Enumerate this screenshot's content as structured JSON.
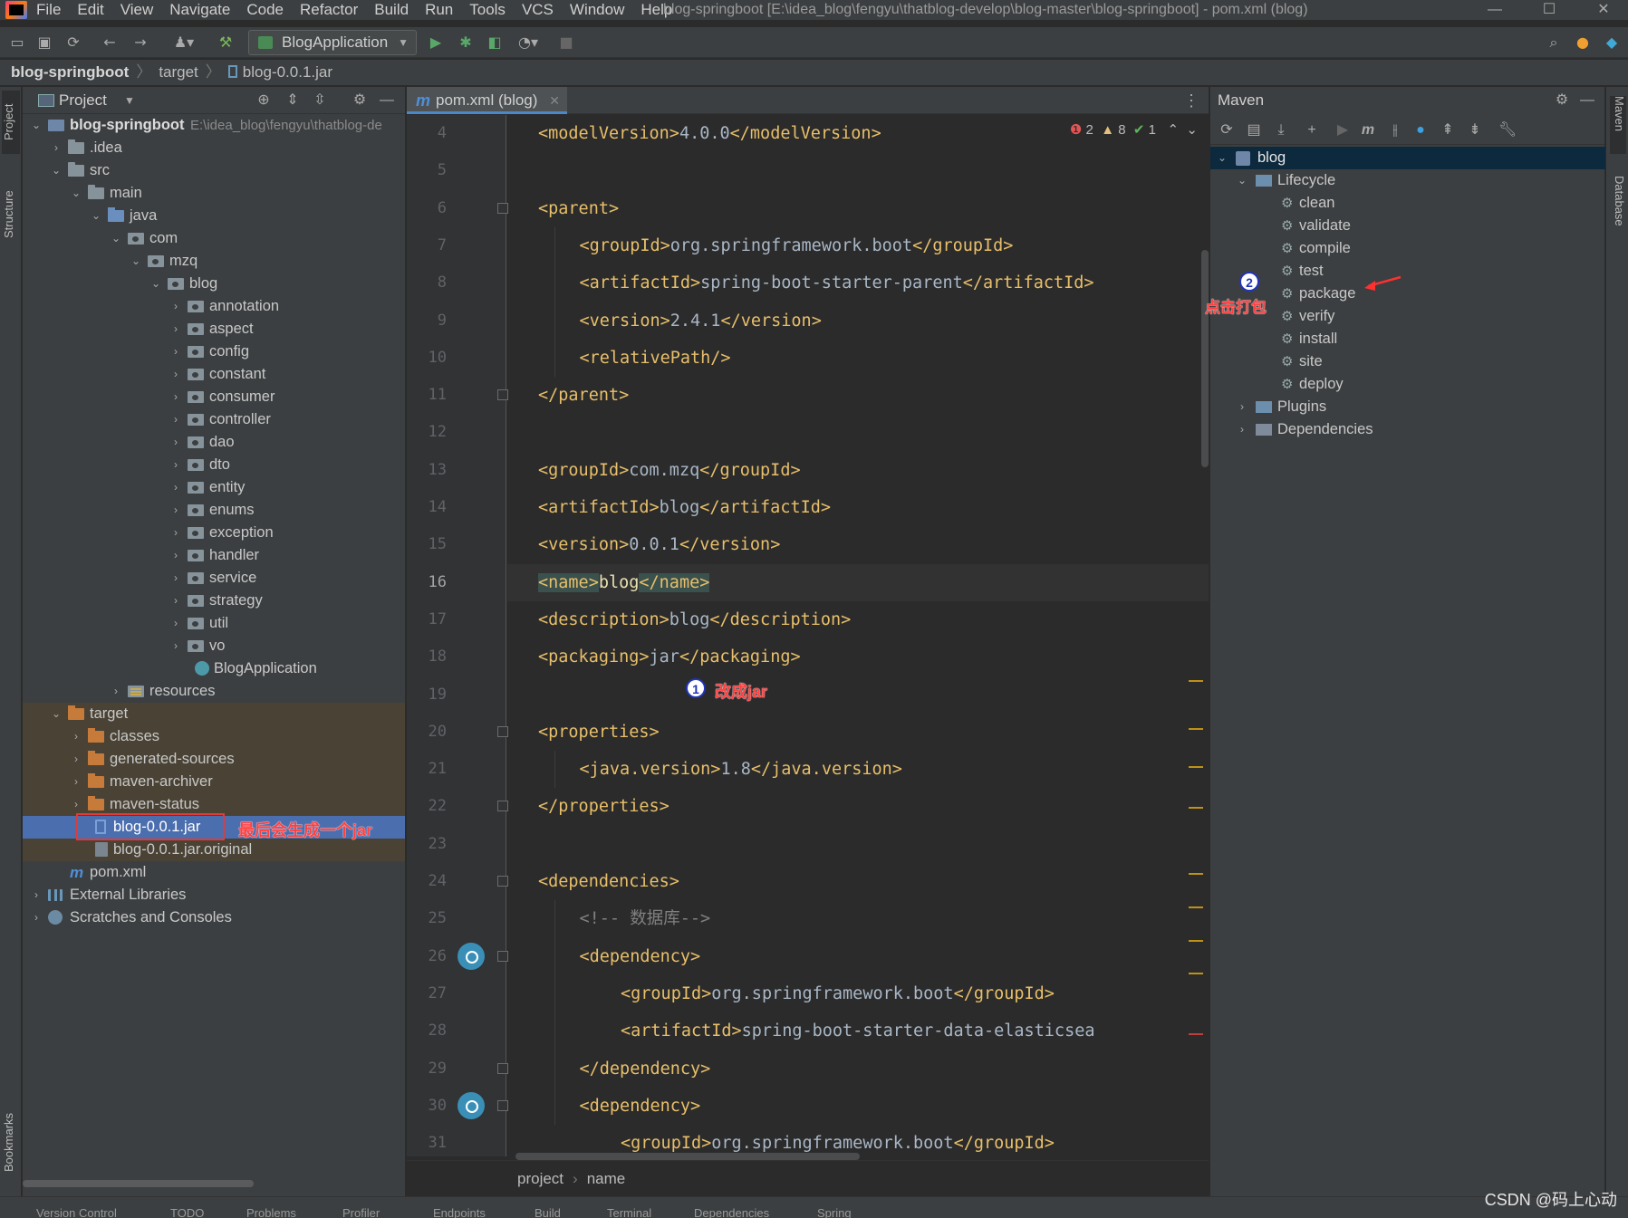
{
  "window": {
    "title": "blog-springboot [E:\\idea_blog\\fengyu\\thatblog-develop\\blog-master\\blog-springboot] - pom.xml (blog)",
    "controls": [
      "—",
      "☐",
      "✕"
    ]
  },
  "menu": [
    "File",
    "Edit",
    "View",
    "Navigate",
    "Code",
    "Refactor",
    "Build",
    "Run",
    "Tools",
    "VCS",
    "Window",
    "Help"
  ],
  "toolbar": {
    "run_config": "BlogApplication"
  },
  "breadcrumb": [
    "blog-springboot",
    "target",
    "blog-0.0.1.jar"
  ],
  "left_strip": {
    "tabs": [
      "Project",
      "Structure",
      "Bookmarks"
    ]
  },
  "project_panel": {
    "title": "Project",
    "root_path": "E:\\idea_blog\\fengyu\\thatblog-de",
    "tree": [
      {
        "label": "blog-springboot"
      },
      {
        "label": ".idea"
      },
      {
        "label": "src"
      },
      {
        "label": "main"
      },
      {
        "label": "java"
      },
      {
        "label": "com"
      },
      {
        "label": "mzq"
      },
      {
        "label": "blog"
      },
      {
        "label": "annotation"
      },
      {
        "label": "aspect"
      },
      {
        "label": "config"
      },
      {
        "label": "constant"
      },
      {
        "label": "consumer"
      },
      {
        "label": "controller"
      },
      {
        "label": "dao"
      },
      {
        "label": "dto"
      },
      {
        "label": "entity"
      },
      {
        "label": "enums"
      },
      {
        "label": "exception"
      },
      {
        "label": "handler"
      },
      {
        "label": "service"
      },
      {
        "label": "strategy"
      },
      {
        "label": "util"
      },
      {
        "label": "vo"
      },
      {
        "label": "BlogApplication"
      },
      {
        "label": "resources"
      },
      {
        "label": "target"
      },
      {
        "label": "classes"
      },
      {
        "label": "generated-sources"
      },
      {
        "label": "maven-archiver"
      },
      {
        "label": "maven-status"
      },
      {
        "label": "blog-0.0.1.jar"
      },
      {
        "label": "blog-0.0.1.jar.original"
      },
      {
        "label": "pom.xml"
      },
      {
        "label": "External Libraries"
      },
      {
        "label": "Scratches and Consoles"
      }
    ],
    "annotation": "最后会生成一个jar"
  },
  "editor": {
    "tab": "pom.xml (blog)",
    "inspections": {
      "errors": "2",
      "warnings": "8",
      "ok": "1"
    },
    "lines": [
      {
        "n": "4",
        "code": "<modelVersion>4.0.0</modelVersion>"
      },
      {
        "n": "5",
        "code": ""
      },
      {
        "n": "6",
        "code": "<parent>"
      },
      {
        "n": "7",
        "code": "<groupId>org.springframework.boot</groupId>"
      },
      {
        "n": "8",
        "code": "<artifactId>spring-boot-starter-parent</artifactId>"
      },
      {
        "n": "9",
        "code": "<version>2.4.1</version>"
      },
      {
        "n": "10",
        "code": "<relativePath/>"
      },
      {
        "n": "11",
        "code": "</parent>"
      },
      {
        "n": "12",
        "code": ""
      },
      {
        "n": "13",
        "code": "<groupId>com.mzq</groupId>"
      },
      {
        "n": "14",
        "code": "<artifactId>blog</artifactId>"
      },
      {
        "n": "15",
        "code": "<version>0.0.1</version>"
      },
      {
        "n": "16",
        "code": "<name>blog</name>"
      },
      {
        "n": "17",
        "code": "<description>blog</description>"
      },
      {
        "n": "18",
        "code": "<packaging>jar</packaging>"
      },
      {
        "n": "19",
        "code": ""
      },
      {
        "n": "20",
        "code": "<properties>"
      },
      {
        "n": "21",
        "code": "<java.version>1.8</java.version>"
      },
      {
        "n": "22",
        "code": "</properties>"
      },
      {
        "n": "23",
        "code": ""
      },
      {
        "n": "24",
        "code": "<dependencies>"
      },
      {
        "n": "25",
        "code": "<!-- 数据库-->"
      },
      {
        "n": "26",
        "code": "<dependency>"
      },
      {
        "n": "27",
        "code": "<groupId>org.springframework.boot</groupId>"
      },
      {
        "n": "28",
        "code": "<artifactId>spring-boot-starter-data-elasticsea"
      },
      {
        "n": "29",
        "code": "</dependency>"
      },
      {
        "n": "30",
        "code": "<dependency>"
      },
      {
        "n": "31",
        "code": "<groupId>org.springframework.boot</groupId>"
      }
    ],
    "annotation_1": {
      "num": "1",
      "text": "改成jar"
    },
    "breadcrumb": [
      "project",
      "name"
    ]
  },
  "maven": {
    "title": "Maven",
    "root": "blog",
    "lifecycle_label": "Lifecycle",
    "phases": [
      "clean",
      "validate",
      "compile",
      "test",
      "package",
      "verify",
      "install",
      "site",
      "deploy"
    ],
    "plugins_label": "Plugins",
    "dependencies_label": "Dependencies",
    "annotation_2": {
      "num": "2",
      "text": "点击打包"
    }
  },
  "right_strip": {
    "tabs": [
      "Maven",
      "Database"
    ]
  },
  "statusbar": {
    "items": [
      "Version Control",
      "TODO",
      "Problems",
      "Profiler",
      "Endpoints",
      "Build",
      "Terminal",
      "Dependencies",
      "Spring"
    ],
    "watermark": "CSDN @码上心动"
  }
}
